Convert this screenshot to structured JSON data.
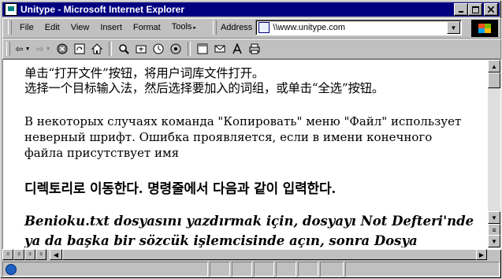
{
  "window": {
    "title": "Unitype - Microsoft Internet Explorer",
    "controls": {
      "minimize": "_",
      "maximize": "□",
      "close": "×"
    }
  },
  "menu": [
    "File",
    "Edit",
    "View",
    "Insert",
    "Format",
    "Tools"
  ],
  "address": {
    "label": "Address",
    "value": "\\\\www.unitype.com"
  },
  "toolbar": {
    "icons": [
      "back-icon",
      "forward-icon",
      "stop-icon",
      "refresh-icon",
      "home-icon",
      "search-icon",
      "favorites-icon",
      "history-icon",
      "channels-icon",
      "fullscreen-icon",
      "mail-icon",
      "font-icon",
      "print-icon"
    ]
  },
  "content": {
    "chinese_line1": "单击“打开文件”按钮，将用户词库文件打开。",
    "chinese_line2": "选择一个目标输入法，然后选择要加入的词组，或单击“全选”按钮。",
    "russian": "В некоторых случаях команда \"Копировать\" меню \"Файл\" использует неверный  шрифт. Ошибка проявляется, если в имени конечного файла присутствует имя",
    "korean": "디렉토리로 이동한다. 명령줄에서 다음과 같이 입력한다.",
    "turkish": "Benioku.txt dosyasını yazdırmak için, dosyayı Not Defteri'nde ya da başka bir sözcük işlemcisinde açın, sonra Dosya menüsündeki"
  },
  "colors": {
    "titlebar": "#000080",
    "chrome": "#c0c0c0"
  }
}
